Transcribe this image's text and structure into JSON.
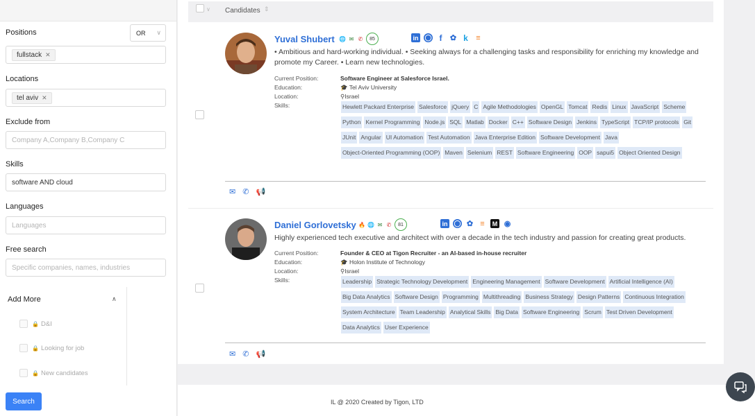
{
  "sidebar": {
    "positions_label": "Positions",
    "positions_operator": "OR",
    "positions_tags": [
      "fullstack"
    ],
    "locations_label": "Locations",
    "locations_tags": [
      "tel aviv"
    ],
    "exclude_label": "Exclude from",
    "exclude_placeholder": "Company A,Company B,Company C",
    "skills_label": "Skills",
    "skills_value": "software AND cloud",
    "languages_label": "Languages",
    "languages_placeholder": "Languages",
    "free_search_label": "Free search",
    "free_search_placeholder": "Specific companies, names, industries",
    "add_more_label": "Add More",
    "add_more_items": [
      "D&I",
      "Looking for job",
      "New candidates"
    ],
    "search_button": "Search"
  },
  "list_header": {
    "title": "Candidates"
  },
  "candidates": [
    {
      "name": "Yuval Shubert",
      "score": "85",
      "summary": "• Ambitious and hard-working individual. • Seeking always for a challenging tasks and responsibility for enriching my knowledge and promote my Career. • Learn new technologies.",
      "current_position_label": "Current Position:",
      "current_position": "Software Engineer at Salesforce Israel.",
      "education_label": "Education:",
      "education": "Tel Aviv University",
      "location_label": "Location:",
      "location": "Israel",
      "skills_label": "Skills:",
      "skills": [
        "Hewlett Packard Enterprise",
        "Salesforce",
        "jQuery",
        "C",
        "Agile Methodologies",
        "OpenGL",
        "Tomcat",
        "Redis",
        "Linux",
        "JavaScript",
        "Scheme",
        "Python",
        "Kernel Programming",
        "Node.js",
        "SQL",
        "Matlab",
        "Docker",
        "C++",
        "Software Design",
        "Jenkins",
        "TypeScript",
        "TCP/IP protocols",
        "Git",
        "JUnit",
        "Angular",
        "UI Automation",
        "Test Automation",
        "Java Enterprise Edition",
        "Software Development",
        "Java",
        "Object-Oriented Programming (OOP)",
        "Maven",
        "Selenium",
        "REST",
        "Software Engineering",
        "OOP",
        "sapui5",
        "Object Oriented Design"
      ]
    },
    {
      "name": "Daniel Gorlovetsky",
      "score": "81",
      "summary": "Highly experienced tech executive and architect with over a decade in the tech industry and passion for creating great products.",
      "current_position_label": "Current Position:",
      "current_position": "Founder & CEO at Tigon Recruiter - an AI-based in-house recruiter",
      "education_label": "Education:",
      "education": "Holon Institute of Technology",
      "location_label": "Location:",
      "location": "Israel",
      "skills_label": "Skills:",
      "skills": [
        "Leadership",
        "Strategic Technology Development",
        "Engineering Management",
        "Software Development",
        "Artificial Intelligence (AI)",
        "Big Data Analytics",
        "Software Design",
        "Programming",
        "Multithreading",
        "Business Strategy",
        "Design Patterns",
        "Continuous Integration",
        "System Architecture",
        "Team Leadership",
        "Analytical Skills",
        "Big Data",
        "Software Engineering",
        "Scrum",
        "Test Driven Development",
        "Data Analytics",
        "User Experience"
      ]
    }
  ],
  "footer": {
    "text": "IL @ 2020 Created by Tigon, LTD"
  },
  "colors": {
    "accent": "#2f6fd6",
    "button": "#3b82f6",
    "skill_bg": "#dfe9f7"
  }
}
